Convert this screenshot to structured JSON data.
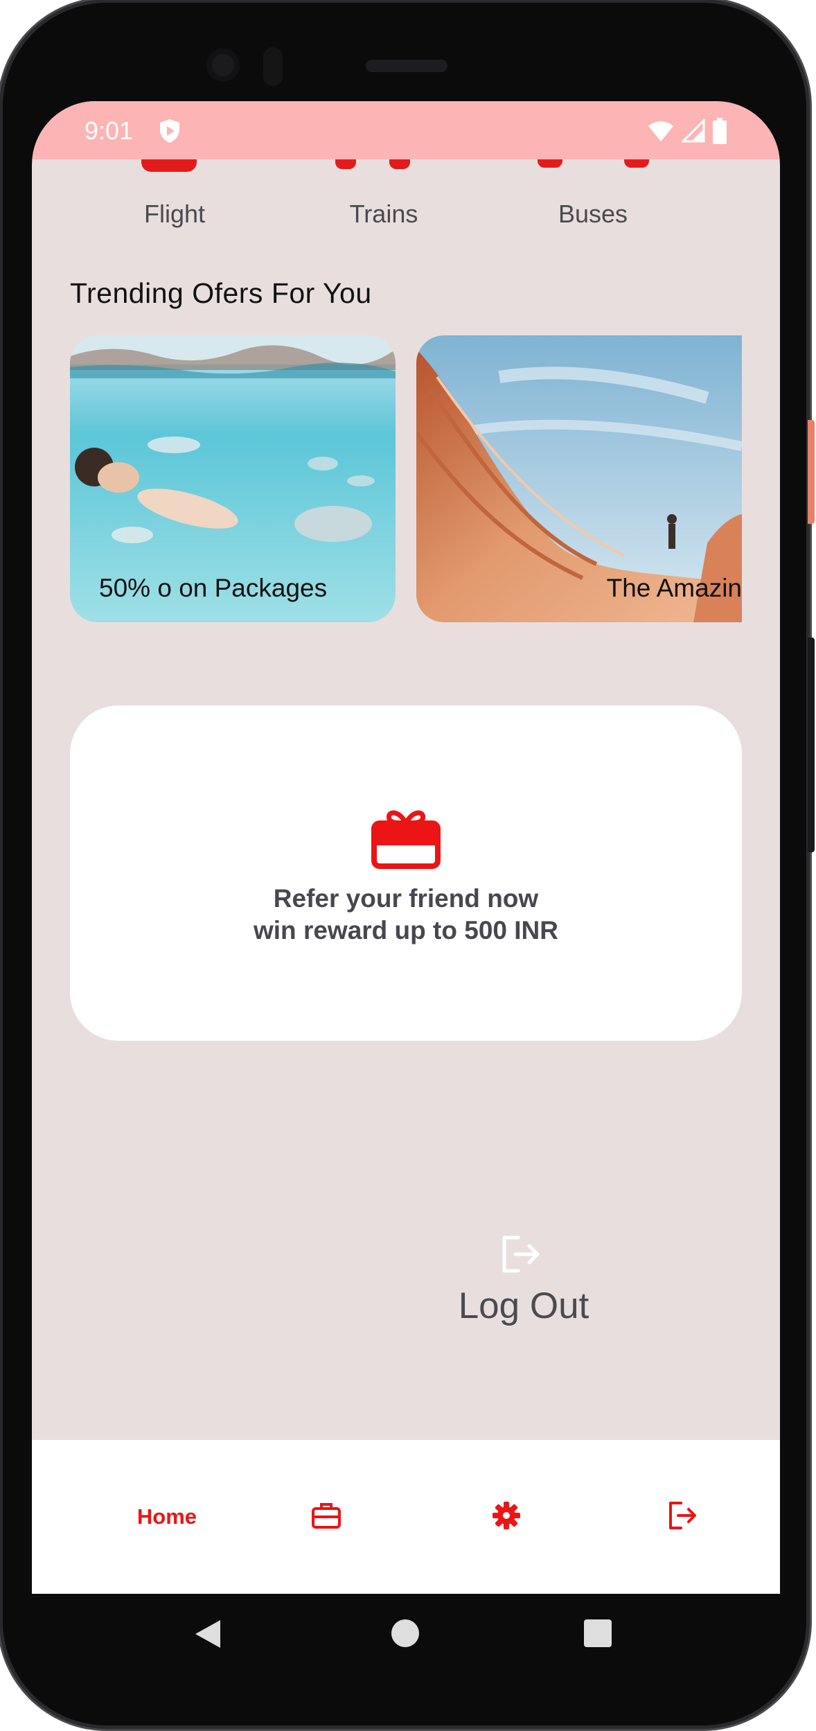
{
  "status_bar": {
    "time": "9:01"
  },
  "transport": {
    "items": [
      {
        "label": "Flight"
      },
      {
        "label": "Trains"
      },
      {
        "label": "Buses"
      }
    ]
  },
  "offers": {
    "title": "Trending Ofers For You",
    "cards": [
      {
        "caption": "50% o on Packages"
      },
      {
        "caption": "The Amazin"
      }
    ]
  },
  "refer": {
    "line1": "Refer your friend now",
    "line2": "win reward up to 500 INR",
    "icon": "gift-icon"
  },
  "logout": {
    "label": "Log Out",
    "icon": "logout-icon"
  },
  "bottom_nav": {
    "home_label": "Home",
    "icons": [
      "briefcase-icon",
      "gear-icon",
      "logout-icon"
    ]
  },
  "colors": {
    "accent": "#ec1414",
    "status_bar": "#fdb4b4",
    "screen_bg": "#e9dede",
    "text_dark": "#48464f"
  }
}
